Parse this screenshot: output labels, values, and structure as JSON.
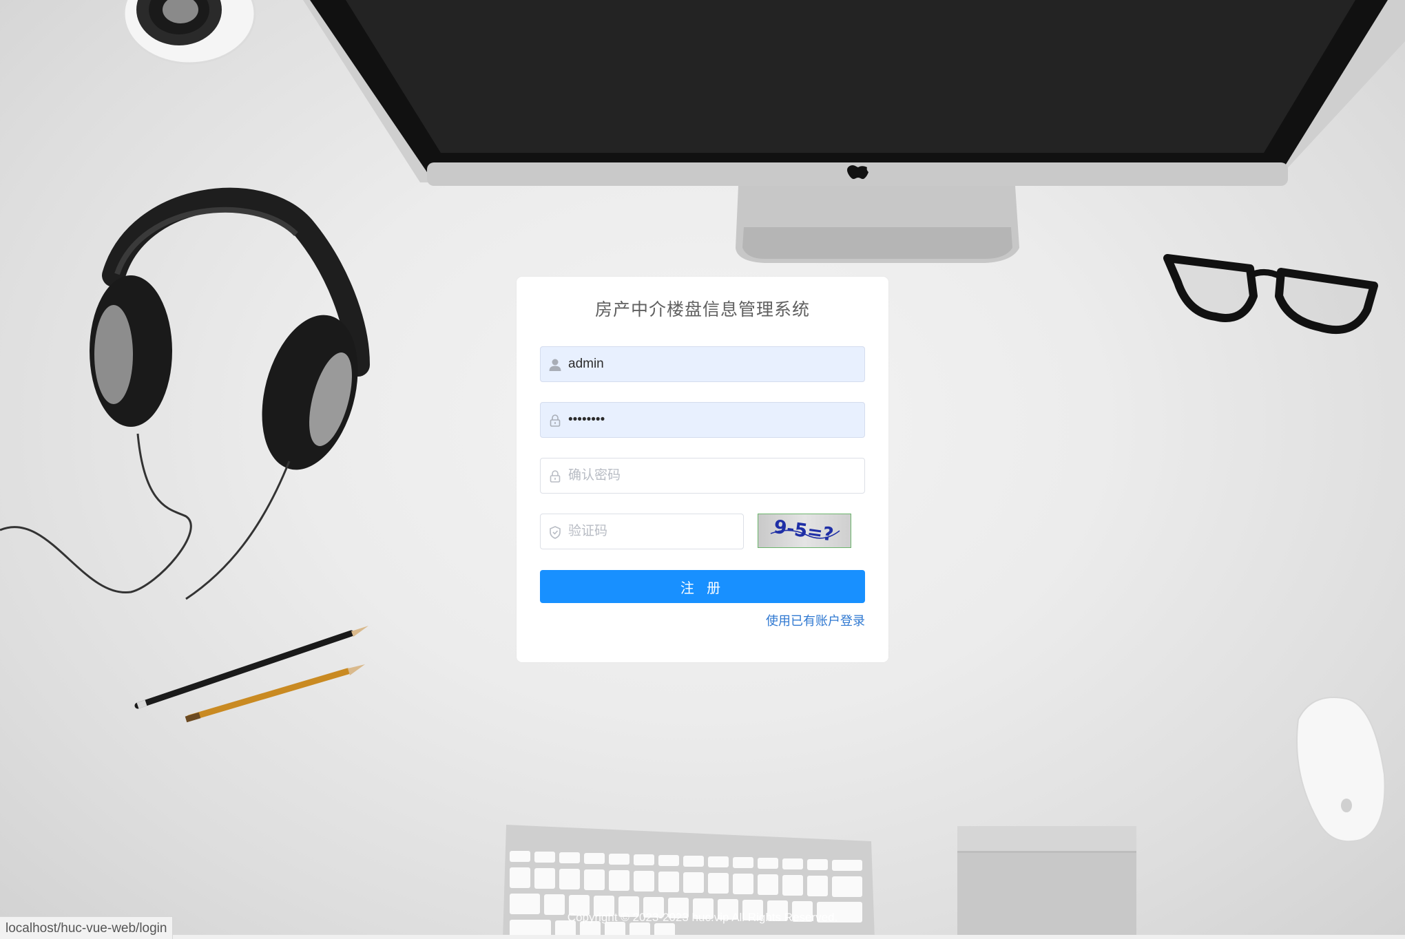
{
  "page": {
    "title": "房产中介楼盘信息管理系统"
  },
  "form": {
    "username": {
      "value": "admin",
      "icon": "user-icon"
    },
    "password": {
      "value": "12345678",
      "icon": "lock-icon"
    },
    "confirm_password": {
      "placeholder": "确认密码",
      "icon": "lock-icon"
    },
    "captcha": {
      "placeholder": "验证码",
      "icon": "shield-icon",
      "image_text": "9-5=?"
    },
    "submit_label": "注 册",
    "login_link": "使用已有账户登录"
  },
  "colors": {
    "primary": "#1890ff",
    "link": "#2f78d1",
    "autofill": "#e8f0fe"
  },
  "footer": {
    "copyright": "Copyright © 2023-2023 huc.vip All Rights Reserved."
  },
  "status_bar": {
    "url": "localhost/huc-vue-web/login"
  }
}
